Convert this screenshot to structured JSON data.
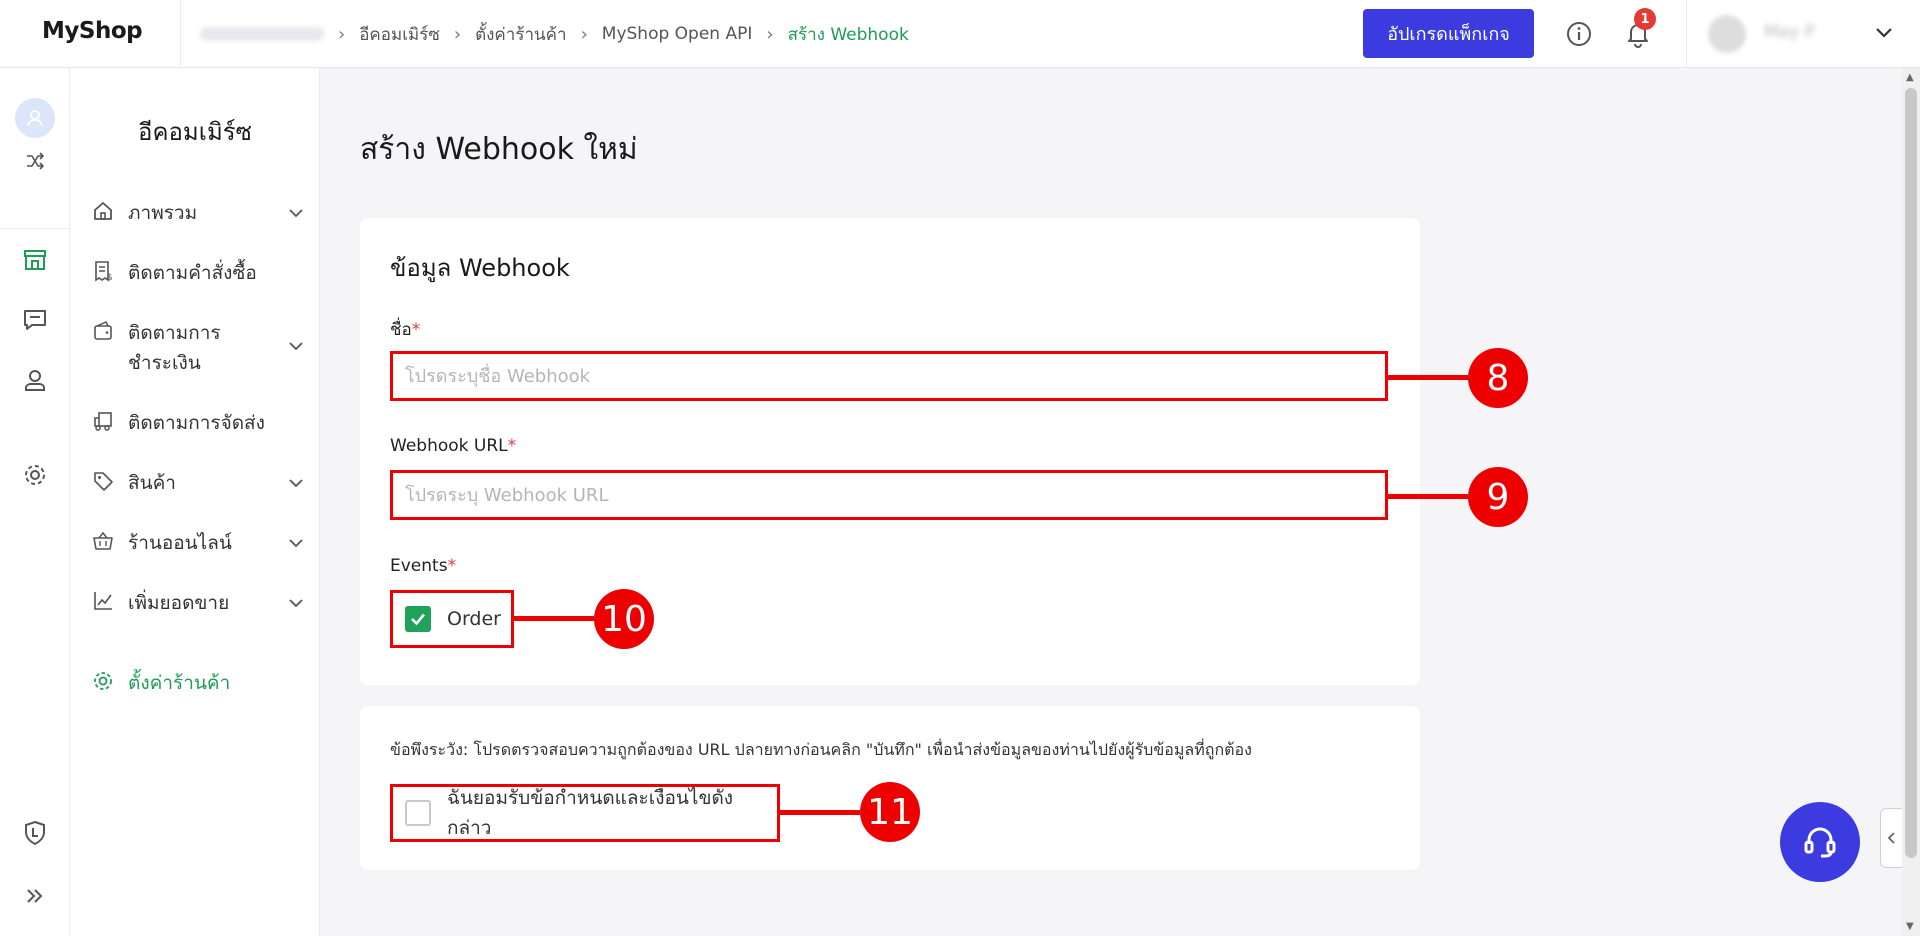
{
  "header": {
    "logo": "MyShop",
    "breadcrumb": [
      "อีคอมเมิร์ซ",
      "ตั้งค่าร้านค้า",
      "MyShop Open API",
      "สร้าง Webhook"
    ],
    "upgrade_label": "อัปเกรดแพ็กเกจ",
    "notification_count": "1",
    "user_name": "May P"
  },
  "sidebar": {
    "title": "อีคอมเมิร์ซ",
    "items": [
      {
        "label": "ภาพรวม",
        "icon": "home-icon"
      },
      {
        "label": "ติดตามคำสั่งซื้อ",
        "icon": "receipt-icon"
      },
      {
        "label": "ติดตามการชำระเงิน",
        "label_line1": "ติดตามการ",
        "label_line2": "ชำระเงิน",
        "icon": "wallet-icon"
      },
      {
        "label": "ติดตามการจัดส่ง",
        "icon": "truck-icon"
      },
      {
        "label": "สินค้า",
        "icon": "tag-icon"
      },
      {
        "label": "ร้านออนไลน์",
        "icon": "basket-icon"
      },
      {
        "label": "เพิ่มยอดขาย",
        "icon": "chart-icon"
      },
      {
        "label": "ตั้งค่าร้านค้า",
        "icon": "gear-icon"
      }
    ]
  },
  "main": {
    "title": "สร้าง Webhook ใหม่",
    "section_title": "ข้อมูล Webhook",
    "name_label": "ชื่อ",
    "name_placeholder": "โปรดระบุชื่อ Webhook",
    "url_label": "Webhook URL",
    "url_placeholder": "โปรดระบุ Webhook URL",
    "events_label": "Events",
    "event_option": "Order",
    "notice": "ข้อพึงระวัง: โปรดตรวจสอบความถูกต้องของ URL ปลายทางก่อนคลิก \"บันทึก\" เพื่อนำส่งข้อมูลของท่านไปยังผู้รับข้อมูลที่ถูกต้อง",
    "agree_label": "ฉันยอมรับข้อกำหนดและเงื่อนไขดังกล่าว",
    "required_mark": "*"
  },
  "callouts": [
    "8",
    "9",
    "10",
    "11"
  ],
  "colors": {
    "primary": "#3b3be0",
    "active_green": "#1f9d55",
    "annotation_red": "#e00000"
  }
}
